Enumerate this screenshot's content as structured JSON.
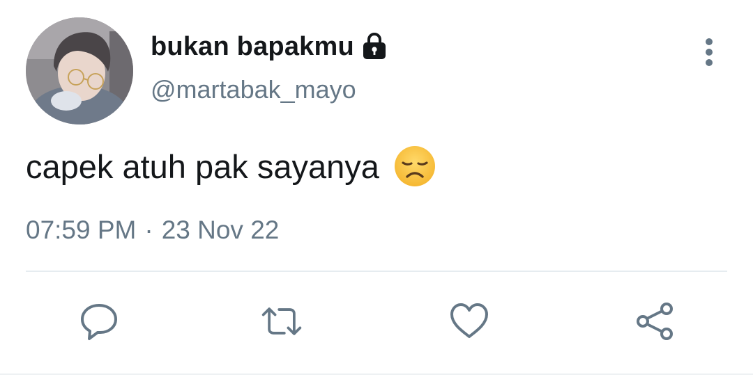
{
  "tweet": {
    "display_name": "bukan bapakmu",
    "handle": "@martabak_mayo",
    "text": "capek atuh pak sayanya",
    "time": "07:59 PM",
    "separator": "·",
    "date": "23 Nov 22",
    "protected": true
  },
  "icons": {
    "lock": "lock-icon",
    "more": "more-vertical-icon",
    "emoji": "disappointed-face-emoji",
    "reply": "reply-icon",
    "retweet": "retweet-icon",
    "like": "heart-icon",
    "share": "share-icon"
  },
  "colors": {
    "text_primary": "#14171a",
    "text_secondary": "#657786",
    "divider": "#e6ecf0"
  }
}
